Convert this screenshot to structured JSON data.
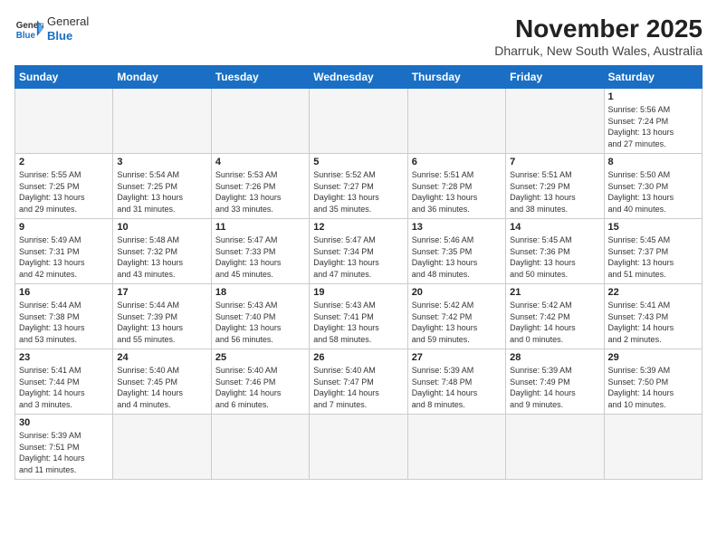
{
  "header": {
    "logo_general": "General",
    "logo_blue": "Blue",
    "month_year": "November 2025",
    "location": "Dharruk, New South Wales, Australia"
  },
  "days_of_week": [
    "Sunday",
    "Monday",
    "Tuesday",
    "Wednesday",
    "Thursday",
    "Friday",
    "Saturday"
  ],
  "weeks": [
    [
      {
        "day": "",
        "info": ""
      },
      {
        "day": "",
        "info": ""
      },
      {
        "day": "",
        "info": ""
      },
      {
        "day": "",
        "info": ""
      },
      {
        "day": "",
        "info": ""
      },
      {
        "day": "",
        "info": ""
      },
      {
        "day": "1",
        "info": "Sunrise: 5:56 AM\nSunset: 7:24 PM\nDaylight: 13 hours\nand 27 minutes."
      }
    ],
    [
      {
        "day": "2",
        "info": "Sunrise: 5:55 AM\nSunset: 7:25 PM\nDaylight: 13 hours\nand 29 minutes."
      },
      {
        "day": "3",
        "info": "Sunrise: 5:54 AM\nSunset: 7:25 PM\nDaylight: 13 hours\nand 31 minutes."
      },
      {
        "day": "4",
        "info": "Sunrise: 5:53 AM\nSunset: 7:26 PM\nDaylight: 13 hours\nand 33 minutes."
      },
      {
        "day": "5",
        "info": "Sunrise: 5:52 AM\nSunset: 7:27 PM\nDaylight: 13 hours\nand 35 minutes."
      },
      {
        "day": "6",
        "info": "Sunrise: 5:51 AM\nSunset: 7:28 PM\nDaylight: 13 hours\nand 36 minutes."
      },
      {
        "day": "7",
        "info": "Sunrise: 5:51 AM\nSunset: 7:29 PM\nDaylight: 13 hours\nand 38 minutes."
      },
      {
        "day": "8",
        "info": "Sunrise: 5:50 AM\nSunset: 7:30 PM\nDaylight: 13 hours\nand 40 minutes."
      }
    ],
    [
      {
        "day": "9",
        "info": "Sunrise: 5:49 AM\nSunset: 7:31 PM\nDaylight: 13 hours\nand 42 minutes."
      },
      {
        "day": "10",
        "info": "Sunrise: 5:48 AM\nSunset: 7:32 PM\nDaylight: 13 hours\nand 43 minutes."
      },
      {
        "day": "11",
        "info": "Sunrise: 5:47 AM\nSunset: 7:33 PM\nDaylight: 13 hours\nand 45 minutes."
      },
      {
        "day": "12",
        "info": "Sunrise: 5:47 AM\nSunset: 7:34 PM\nDaylight: 13 hours\nand 47 minutes."
      },
      {
        "day": "13",
        "info": "Sunrise: 5:46 AM\nSunset: 7:35 PM\nDaylight: 13 hours\nand 48 minutes."
      },
      {
        "day": "14",
        "info": "Sunrise: 5:45 AM\nSunset: 7:36 PM\nDaylight: 13 hours\nand 50 minutes."
      },
      {
        "day": "15",
        "info": "Sunrise: 5:45 AM\nSunset: 7:37 PM\nDaylight: 13 hours\nand 51 minutes."
      }
    ],
    [
      {
        "day": "16",
        "info": "Sunrise: 5:44 AM\nSunset: 7:38 PM\nDaylight: 13 hours\nand 53 minutes."
      },
      {
        "day": "17",
        "info": "Sunrise: 5:44 AM\nSunset: 7:39 PM\nDaylight: 13 hours\nand 55 minutes."
      },
      {
        "day": "18",
        "info": "Sunrise: 5:43 AM\nSunset: 7:40 PM\nDaylight: 13 hours\nand 56 minutes."
      },
      {
        "day": "19",
        "info": "Sunrise: 5:43 AM\nSunset: 7:41 PM\nDaylight: 13 hours\nand 58 minutes."
      },
      {
        "day": "20",
        "info": "Sunrise: 5:42 AM\nSunset: 7:42 PM\nDaylight: 13 hours\nand 59 minutes."
      },
      {
        "day": "21",
        "info": "Sunrise: 5:42 AM\nSunset: 7:42 PM\nDaylight: 14 hours\nand 0 minutes."
      },
      {
        "day": "22",
        "info": "Sunrise: 5:41 AM\nSunset: 7:43 PM\nDaylight: 14 hours\nand 2 minutes."
      }
    ],
    [
      {
        "day": "23",
        "info": "Sunrise: 5:41 AM\nSunset: 7:44 PM\nDaylight: 14 hours\nand 3 minutes."
      },
      {
        "day": "24",
        "info": "Sunrise: 5:40 AM\nSunset: 7:45 PM\nDaylight: 14 hours\nand 4 minutes."
      },
      {
        "day": "25",
        "info": "Sunrise: 5:40 AM\nSunset: 7:46 PM\nDaylight: 14 hours\nand 6 minutes."
      },
      {
        "day": "26",
        "info": "Sunrise: 5:40 AM\nSunset: 7:47 PM\nDaylight: 14 hours\nand 7 minutes."
      },
      {
        "day": "27",
        "info": "Sunrise: 5:39 AM\nSunset: 7:48 PM\nDaylight: 14 hours\nand 8 minutes."
      },
      {
        "day": "28",
        "info": "Sunrise: 5:39 AM\nSunset: 7:49 PM\nDaylight: 14 hours\nand 9 minutes."
      },
      {
        "day": "29",
        "info": "Sunrise: 5:39 AM\nSunset: 7:50 PM\nDaylight: 14 hours\nand 10 minutes."
      }
    ],
    [
      {
        "day": "30",
        "info": "Sunrise: 5:39 AM\nSunset: 7:51 PM\nDaylight: 14 hours\nand 11 minutes."
      },
      {
        "day": "",
        "info": ""
      },
      {
        "day": "",
        "info": ""
      },
      {
        "day": "",
        "info": ""
      },
      {
        "day": "",
        "info": ""
      },
      {
        "day": "",
        "info": ""
      },
      {
        "day": "",
        "info": ""
      }
    ]
  ]
}
